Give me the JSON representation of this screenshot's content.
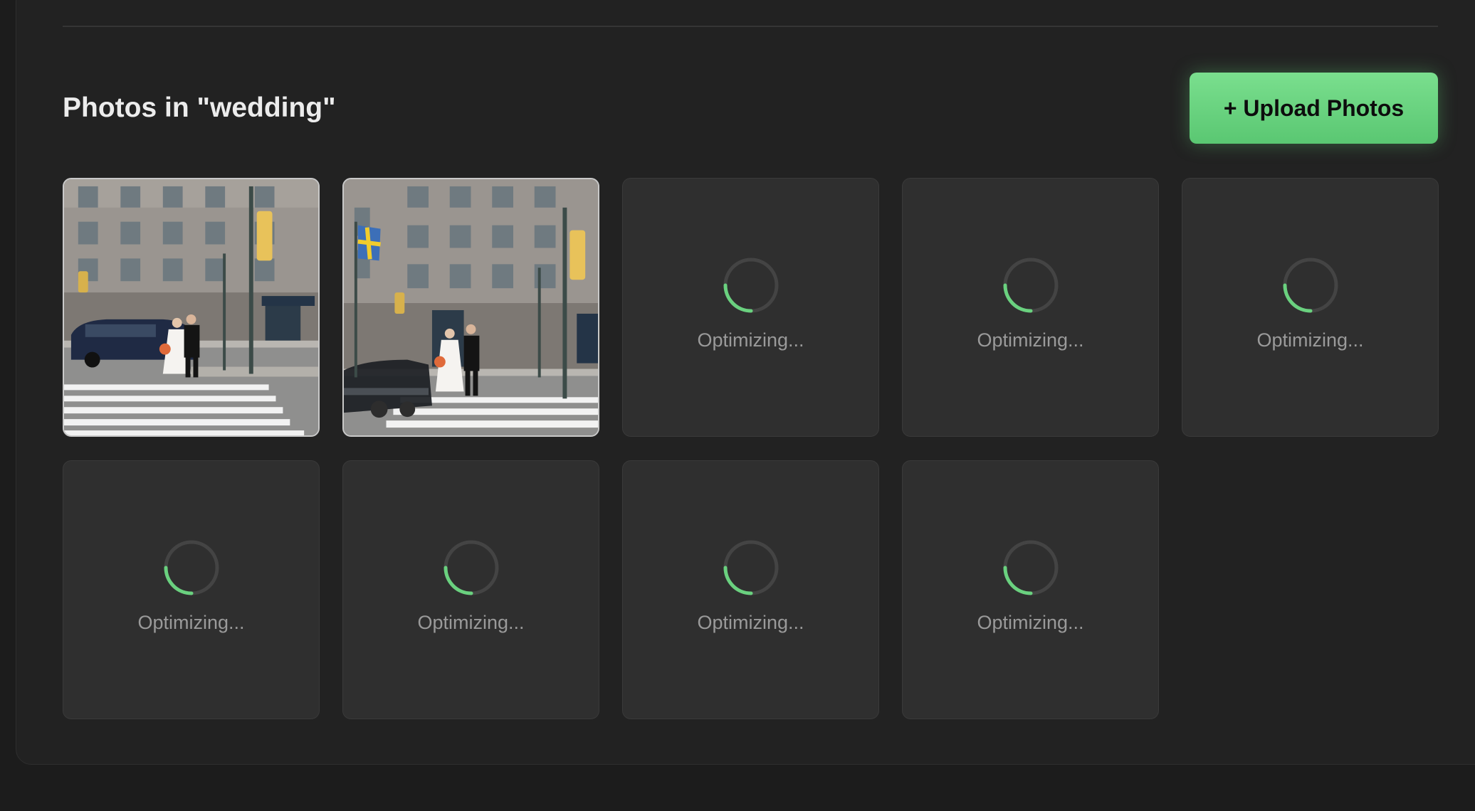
{
  "section": {
    "title": "Photos in \"wedding\"",
    "upload_label": "+ Upload Photos"
  },
  "photos": [
    {
      "status": "loaded",
      "subject": "wedding-couple-crosswalk"
    },
    {
      "status": "loaded",
      "subject": "wedding-couple-crosswalk-motion-car"
    },
    {
      "status": "optimizing",
      "label": "Optimizing..."
    },
    {
      "status": "optimizing",
      "label": "Optimizing..."
    },
    {
      "status": "optimizing",
      "label": "Optimizing..."
    },
    {
      "status": "optimizing",
      "label": "Optimizing..."
    },
    {
      "status": "optimizing",
      "label": "Optimizing..."
    },
    {
      "status": "optimizing",
      "label": "Optimizing..."
    },
    {
      "status": "optimizing",
      "label": "Optimizing..."
    }
  ],
  "colors": {
    "accent": "#6ad17f",
    "spinner_track": "#444444",
    "tile_bg": "#2f2f2f"
  },
  "icons": {
    "spinner": "loading-spinner-icon"
  }
}
